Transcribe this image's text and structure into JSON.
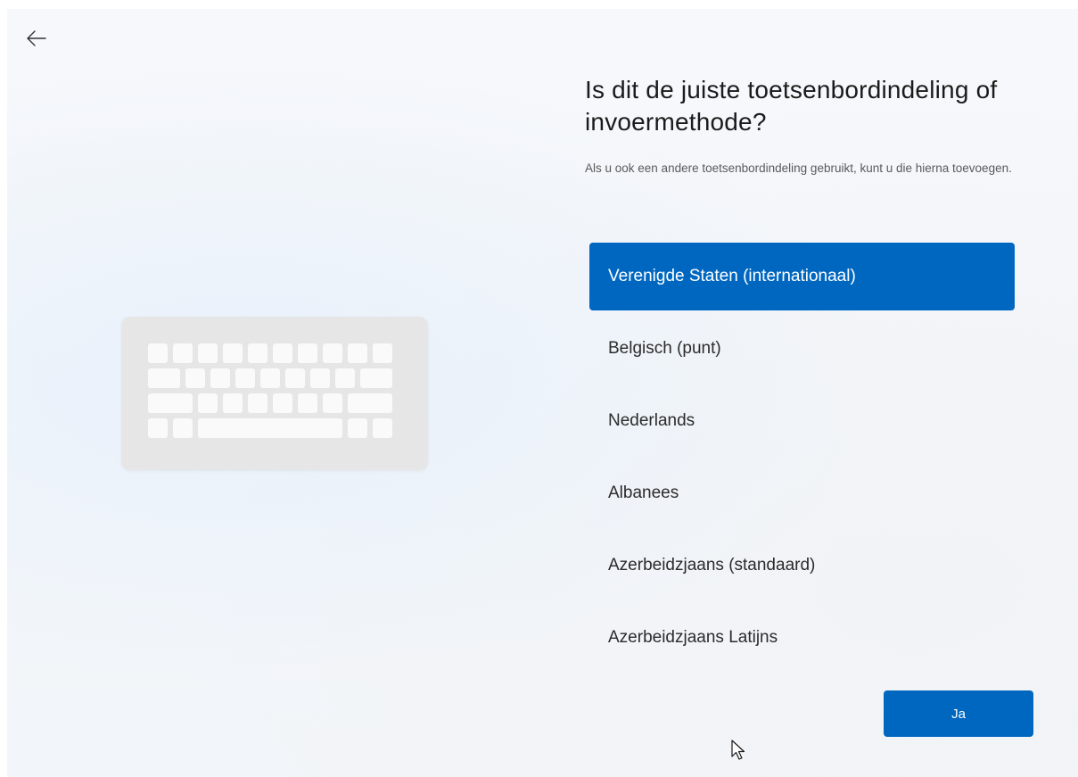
{
  "header": {
    "back_icon": "arrow-left-icon"
  },
  "illustration": {
    "icon": "keyboard-icon"
  },
  "main": {
    "title": "Is dit de juiste toetsenbordindeling of invoermethode?",
    "subtitle": "Als u ook een andere toetsenbordindeling gebruikt, kunt u die hierna toevoegen."
  },
  "layouts": {
    "items": [
      {
        "label": "Verenigde Staten (internationaal)",
        "selected": true
      },
      {
        "label": "Belgisch (punt)",
        "selected": false
      },
      {
        "label": "Nederlands",
        "selected": false
      },
      {
        "label": "Albanees",
        "selected": false
      },
      {
        "label": "Azerbeidzjaans (standaard)",
        "selected": false
      },
      {
        "label": "Azerbeidzjaans Latijns",
        "selected": false
      }
    ]
  },
  "footer": {
    "confirm_label": "Ja"
  },
  "colors": {
    "accent": "#0067c0",
    "background": "#f3f6fa",
    "keyboard_body": "#e6e6e6",
    "keyboard_key": "#fafafa"
  }
}
